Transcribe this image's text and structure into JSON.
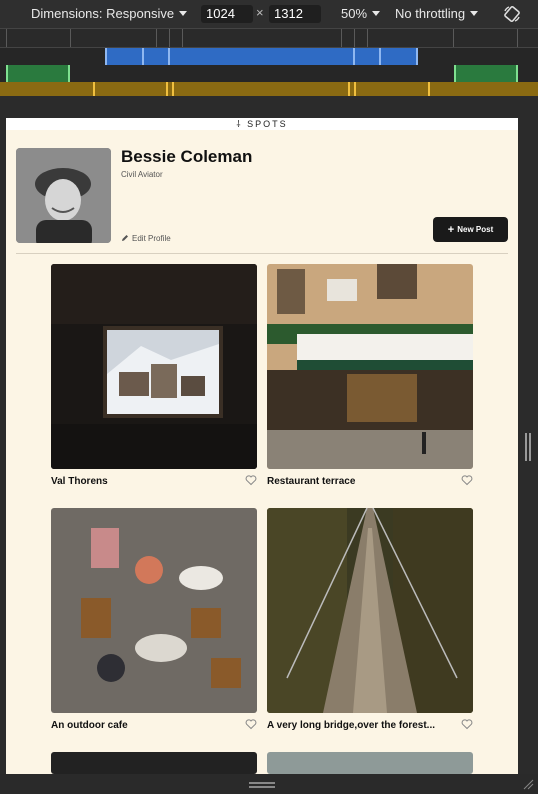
{
  "devtools": {
    "dimensions_label": "Dimensions: Responsive",
    "width_value": "1024",
    "height_value": "1312",
    "separator": "×",
    "zoom_label": "50%",
    "throttle_label": "No throttling"
  },
  "site": {
    "logo": "SPOTS"
  },
  "profile": {
    "name": "Bessie Coleman",
    "title": "Civil Aviator",
    "edit_label": "Edit Profile",
    "new_post_label": "New Post"
  },
  "cards": [
    {
      "caption": "Val Thorens"
    },
    {
      "caption": "Restaurant terrace"
    },
    {
      "caption": "An outdoor cafe"
    },
    {
      "caption": "A very long bridge,over the forest..."
    }
  ],
  "colors": {
    "page_bg": "#fcf5e5",
    "button_bg": "#1a1a1a",
    "media_blue": "#2f6bc4",
    "media_green": "#2a7a3e",
    "media_gold": "#8a6a12"
  }
}
